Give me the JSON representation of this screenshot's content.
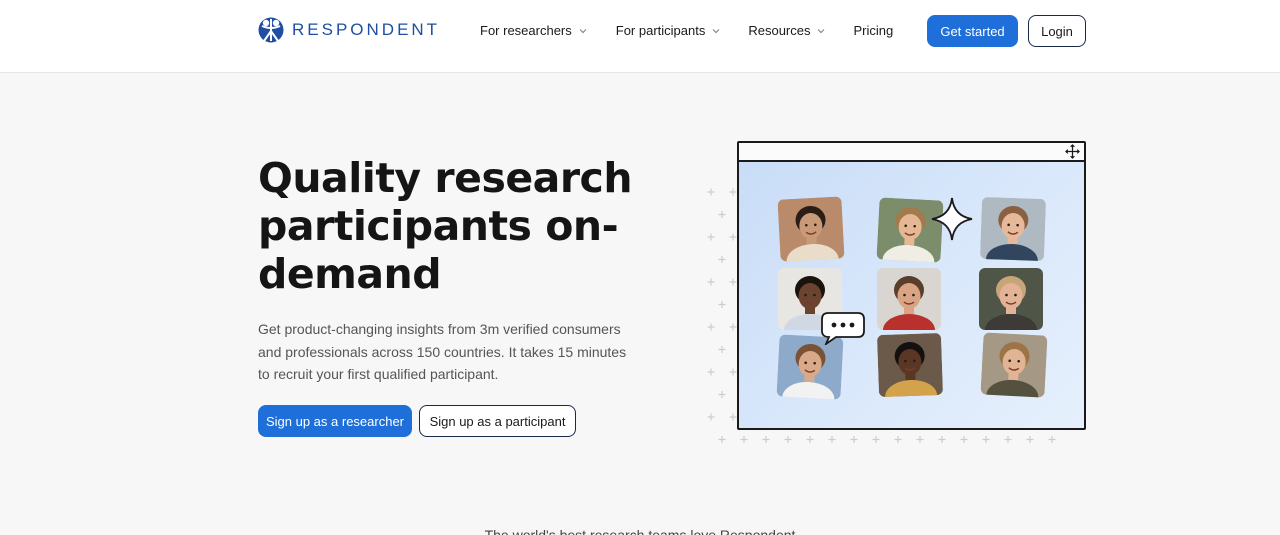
{
  "brand": {
    "name": "RESPONDENT",
    "color": "#1e4fa3",
    "accent": "#1e6fd9"
  },
  "nav": {
    "items": [
      {
        "label": "For researchers",
        "dropdown": true
      },
      {
        "label": "For participants",
        "dropdown": true
      },
      {
        "label": "Resources",
        "dropdown": true
      },
      {
        "label": "Pricing",
        "dropdown": false
      }
    ],
    "get_started": "Get started",
    "login": "Login"
  },
  "hero": {
    "title": "Quality research participants on-demand",
    "subtitle": "Get product-changing insights from 3m verified consumers and professionals across 150 countries. It takes 15 minutes to recruit your first qualified participant.",
    "cta_researcher": "Sign up as a researcher",
    "cta_participant": "Sign up as a participant"
  },
  "illustration": {
    "icons": [
      "move-icon",
      "sparkle-icon",
      "chat-bubble-icon"
    ],
    "participants": [
      {
        "skin": "#c99a78",
        "hair": "#2b1d16",
        "shirt": "#e9dcc8",
        "bg": "#b98b6b"
      },
      {
        "skin": "#e4b893",
        "hair": "#a37a4c",
        "shirt": "#f0ede4",
        "bg": "#7b8d6a"
      },
      {
        "skin": "#e6b99a",
        "hair": "#8a6040",
        "shirt": "#31465e",
        "bg": "#aeb9c2"
      },
      {
        "skin": "#6b4430",
        "hair": "#1a120d",
        "shirt": "#cfd8e3",
        "bg": "#e8e6e2"
      },
      {
        "skin": "#d8a483",
        "hair": "#5a3e2b",
        "shirt": "#b8312c",
        "bg": "#d9d6d2"
      },
      {
        "skin": "#e2b396",
        "hair": "#c7a579",
        "shirt": "#3d3a38",
        "bg": "#4f5648"
      },
      {
        "skin": "#d9a98a",
        "hair": "#7a5236",
        "shirt": "#f2f2f2",
        "bg": "#8eaacb"
      },
      {
        "skin": "#5a3624",
        "hair": "#151010",
        "shirt": "#d4a24a",
        "bg": "#6b5a4a"
      },
      {
        "skin": "#e1b494",
        "hair": "#9c7448",
        "shirt": "#54513e",
        "bg": "#a59884"
      }
    ]
  },
  "trusted": {
    "text": "The world's best research teams love Respondent"
  }
}
